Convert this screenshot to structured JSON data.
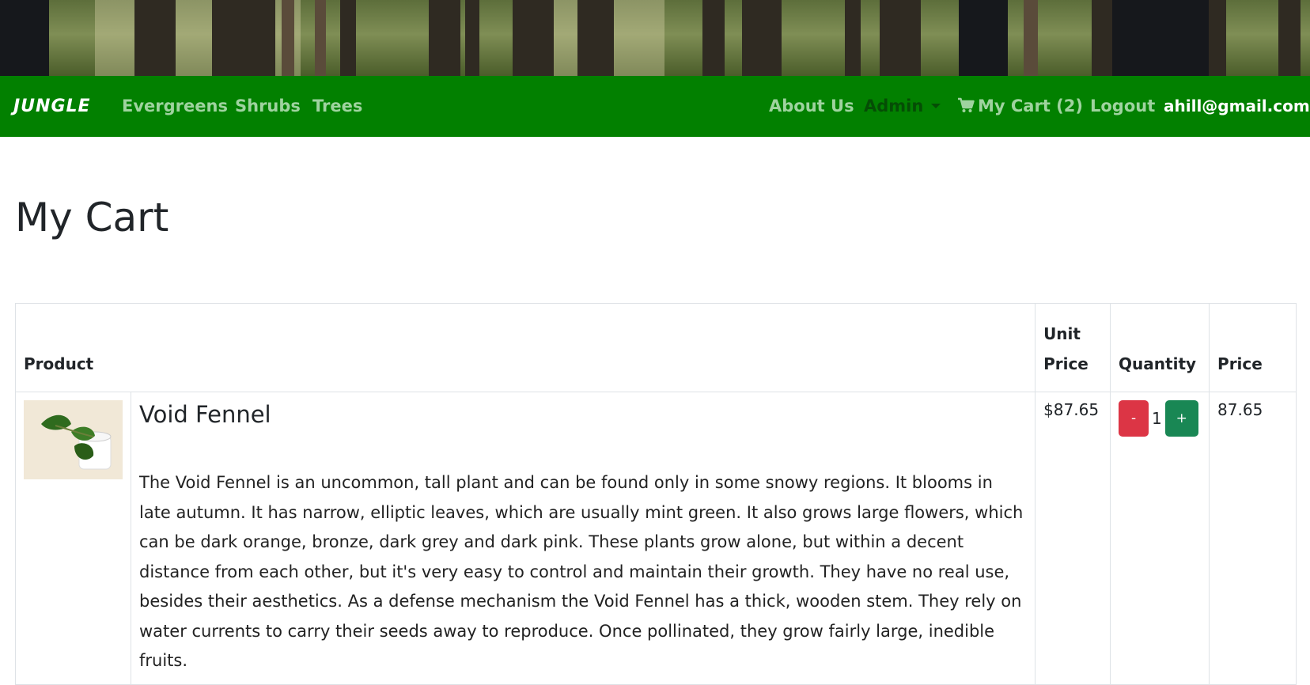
{
  "navbar": {
    "brand": "JUNGLE",
    "links_left": [
      "Evergreens",
      "Shrubs",
      "Trees"
    ],
    "about": "About Us",
    "admin": "Admin",
    "cart": "My Cart (2)",
    "logout": "Logout",
    "email": "ahill@gmail.com"
  },
  "page": {
    "title": "My Cart"
  },
  "table": {
    "headers": {
      "product": "Product",
      "unit_price": "Unit Price",
      "quantity": "Quantity",
      "price": "Price"
    },
    "rows": [
      {
        "name": "Void Fennel",
        "description": "The Void Fennel is an uncommon, tall plant and can be found only in some snowy regions. It blooms in late autumn. It has narrow, elliptic leaves, which are usually mint green. It also grows large flowers, which can be dark orange, bronze, dark grey and dark pink. These plants grow alone, but within a decent distance from each other, but it's very easy to control and maintain their growth. They have no real use, besides their aesthetics. As a defense mechanism the Void Fennel has a thick, wooden stem. They rely on water currents to carry their seeds away to reproduce. Once pollinated, they grow fairly large, inedible fruits.",
        "unit_price": "$87.65",
        "decrement": "-",
        "quantity": "1",
        "increment": "+",
        "price": "87.65"
      }
    ]
  },
  "colors": {
    "navbar": "#028000",
    "minus_button": "#dc3545",
    "plus_button": "#198754"
  },
  "icons": {
    "cart": "shopping-cart-icon",
    "admin_caret": "chevron-down-icon"
  }
}
